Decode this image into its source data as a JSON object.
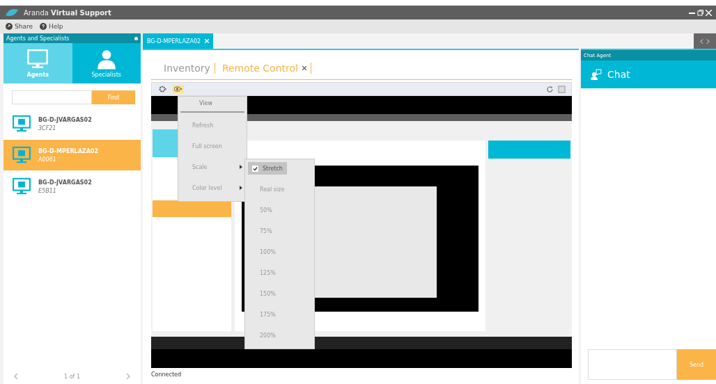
{
  "window": {
    "title": "Aranda **Virtual Support**"
  },
  "toolbar": [
    {
      "label": "Share",
      "kind": "share"
    },
    {
      "label": "Help",
      "kind": "help"
    }
  ],
  "sidebar": {
    "title": "Agents and Specialists",
    "tabs": [
      {
        "label": "Agents",
        "kind": "monitor",
        "selected": true
      },
      {
        "label": "Specialists",
        "kind": "person",
        "selected": false
      }
    ],
    "search": {
      "button": "Find"
    },
    "agents": [
      {
        "name": "BG-D-JVARGAS02",
        "code": "3CF21",
        "selected": false
      },
      {
        "name": "BG-D-MPERLAZA02",
        "code": "A0061",
        "selected": true
      },
      {
        "name": "BG-D-JVARGAS02",
        "code": "E5B11",
        "selected": false
      }
    ],
    "pager": {
      "page": "1 of 1"
    }
  },
  "session_tabs": [
    {
      "label": "BG-D-MPERLAZA02",
      "selected": true
    }
  ],
  "view_tabs": [
    {
      "label": "Inventory",
      "selected": false,
      "closable": false
    },
    {
      "label": "Remote Control",
      "selected": true,
      "closable": true
    }
  ],
  "view_menu": [
    {
      "label": "View",
      "kind": "header"
    },
    {
      "label": "Refresh",
      "kind": "item"
    },
    {
      "label": "Full screen",
      "kind": "item"
    },
    {
      "label": "Scale",
      "kind": "submenu"
    },
    {
      "label": "Color level",
      "kind": "submenu"
    }
  ],
  "scale_menu": [
    {
      "label": "Stretch",
      "checked": true
    },
    {
      "label": "Real size",
      "checked": false
    },
    {
      "label": "50%",
      "checked": false
    },
    {
      "label": "75%",
      "checked": false
    },
    {
      "label": "100%",
      "checked": false
    },
    {
      "label": "125%",
      "checked": false
    },
    {
      "label": "150%",
      "checked": false
    },
    {
      "label": "175%",
      "checked": false
    },
    {
      "label": "200%",
      "checked": false
    }
  ],
  "status_bar": "Connected",
  "chat": {
    "panel_title": "Chat Agent",
    "title": "Chat",
    "send": "Send"
  }
}
